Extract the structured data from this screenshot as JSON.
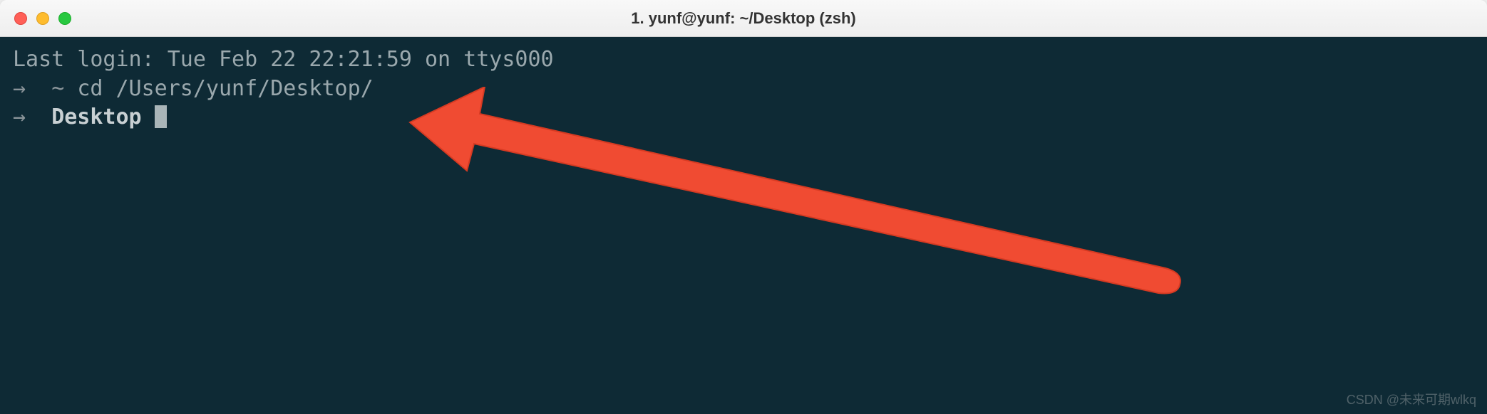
{
  "window": {
    "title": "1. yunf@yunf: ~/Desktop (zsh)"
  },
  "terminal": {
    "last_login": "Last login: Tue Feb 22 22:21:59 on ttys000",
    "prompt_arrow": "→",
    "line1_tilde": "~",
    "line1_cmd": "cd /Users/yunf/Desktop/",
    "line2_dir": "Desktop"
  },
  "watermark": "CSDN @未来可期wlkq"
}
